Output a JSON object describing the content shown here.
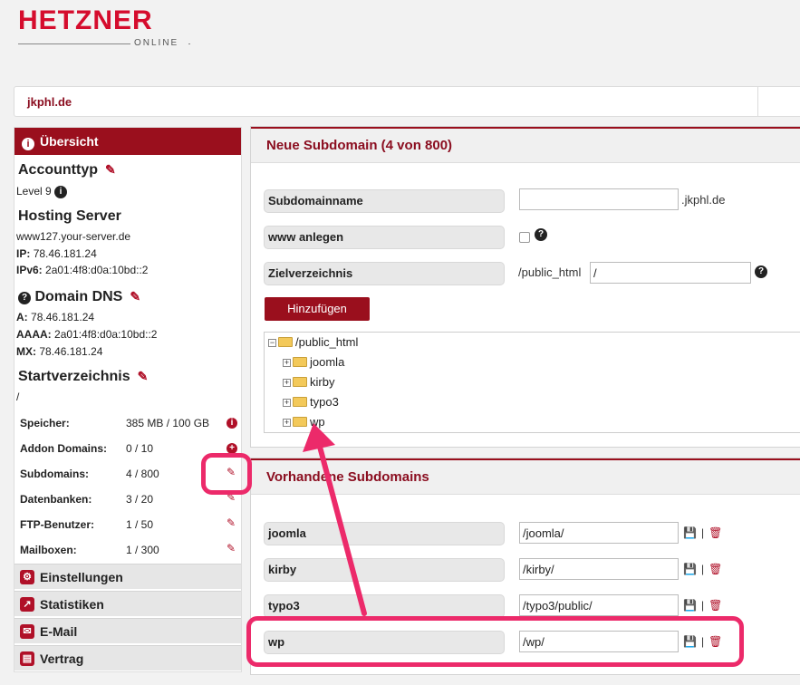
{
  "logo": {
    "main": "HETZNER",
    "sub": "ONLINE"
  },
  "domain": "jkphl.de",
  "sidebar": {
    "header": "Übersicht",
    "accounttyp": {
      "title": "Accounttyp",
      "level": "Level 9"
    },
    "hosting": {
      "title": "Hosting Server",
      "host": "www127.your-server.de",
      "ip_label": "IP:",
      "ip": "78.46.181.24",
      "ipv6_label": "IPv6:",
      "ipv6": "2a01:4f8:d0a:10bd::2"
    },
    "dns": {
      "title": "Domain DNS",
      "a_label": "A:",
      "a": "78.46.181.24",
      "aaaa_label": "AAAA:",
      "aaaa": "2a01:4f8:d0a:10bd::2",
      "mx_label": "MX:",
      "mx": "78.46.181.24"
    },
    "startverzeichnis": {
      "title": "Startverzeichnis",
      "value": "/"
    },
    "stats": [
      {
        "label": "Speicher:",
        "value": "385 MB / 100 GB"
      },
      {
        "label": "Addon Domains:",
        "value": "0 / 10"
      },
      {
        "label": "Subdomains:",
        "value": "4 / 800"
      },
      {
        "label": "Datenbanken:",
        "value": "3 / 20"
      },
      {
        "label": "FTP-Benutzer:",
        "value": "1 / 50"
      },
      {
        "label": "Mailboxen:",
        "value": "1 / 300"
      }
    ],
    "nav": [
      "Einstellungen",
      "Statistiken",
      "E-Mail",
      "Vertrag"
    ]
  },
  "new_subdomain": {
    "title": "Neue Subdomain (4 von 800)",
    "name_label": "Subdomainname",
    "name_value": "",
    "name_suffix": ".jkphl.de",
    "www_label": "www anlegen",
    "target_label": "Zielverzeichnis",
    "target_prefix": "/public_html",
    "target_value": "/",
    "button": "Hinzufügen",
    "tree": {
      "root": "/public_html",
      "children": [
        "joomla",
        "kirby",
        "typo3",
        "wp"
      ]
    }
  },
  "existing": {
    "title": "Vorhandene Subdomains",
    "rows": [
      {
        "name": "joomla",
        "path": "/joomla/"
      },
      {
        "name": "kirby",
        "path": "/kirby/"
      },
      {
        "name": "typo3",
        "path": "/typo3/public/"
      },
      {
        "name": "wp",
        "path": "/wp/"
      }
    ]
  },
  "colors": {
    "brand": "#d50c2d",
    "header": "#9a0f1d",
    "highlight": "#ec2a6a"
  }
}
